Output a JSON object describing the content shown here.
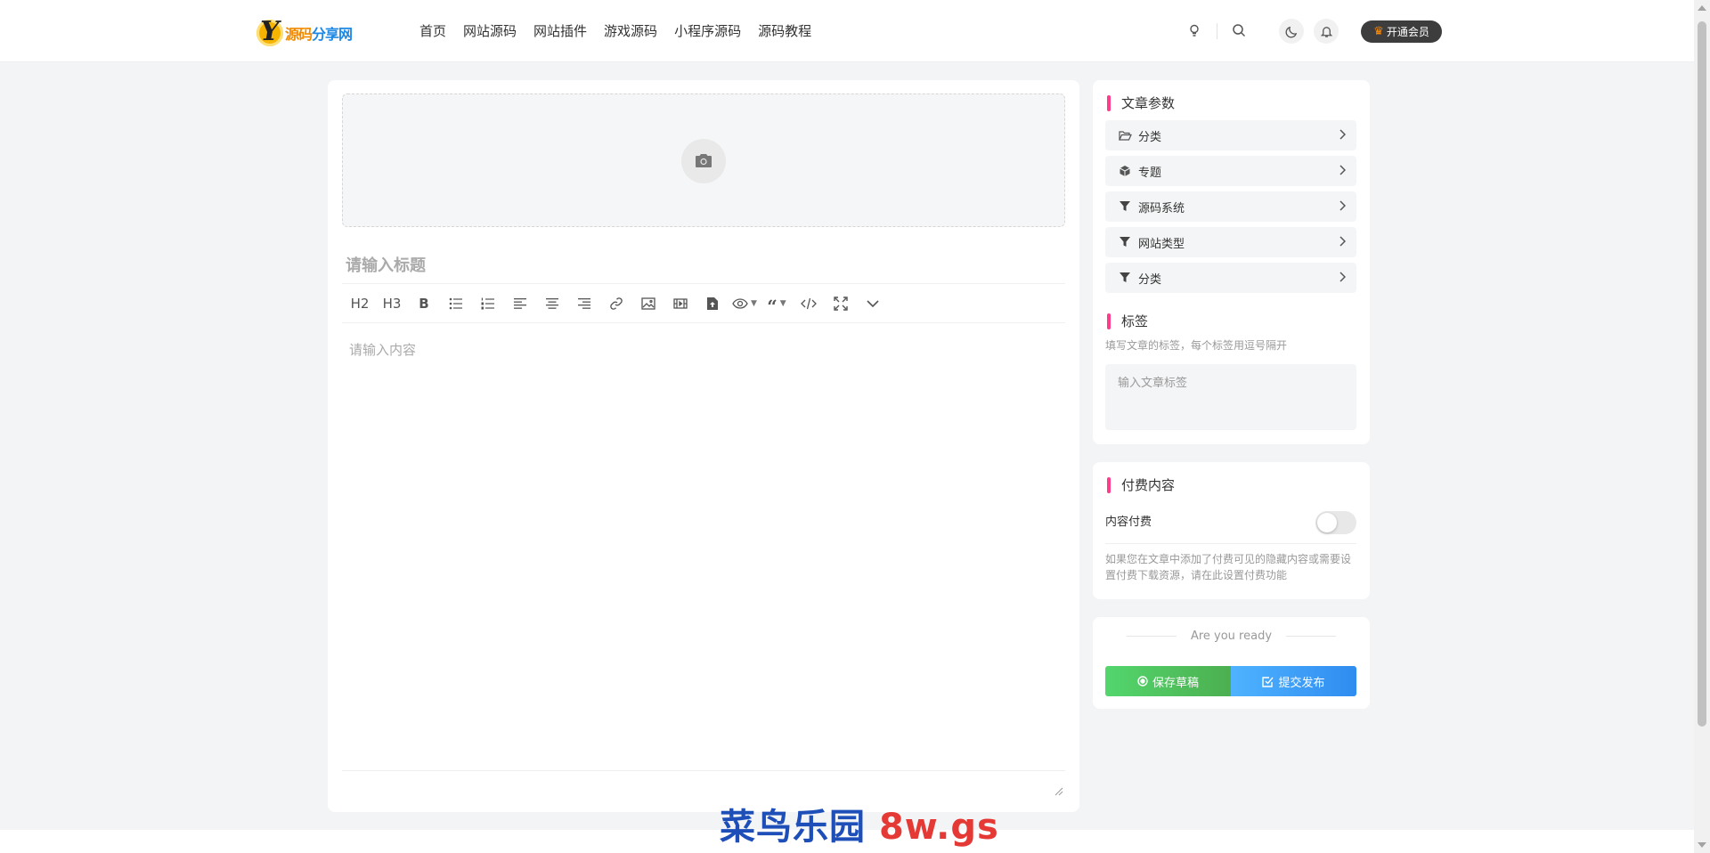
{
  "header": {
    "logo_text_a": "源码",
    "logo_text_b": "分享网",
    "nav": [
      "首页",
      "网站源码",
      "网站插件",
      "游戏源码",
      "小程序源码",
      "源码教程"
    ],
    "vip_label": "开通会员"
  },
  "editor": {
    "title_placeholder": "请输入标题",
    "content_placeholder": "请输入内容",
    "toolbar": {
      "h2": "H2",
      "h3": "H3",
      "bold": "B"
    }
  },
  "params": {
    "title": "文章参数",
    "rows": [
      {
        "label": "分类",
        "icon": "folder-open-icon"
      },
      {
        "label": "专题",
        "icon": "cube-icon"
      },
      {
        "label": "源码系统",
        "icon": "filter-icon"
      },
      {
        "label": "网站类型",
        "icon": "filter-icon"
      },
      {
        "label": "分类",
        "icon": "filter-icon"
      }
    ]
  },
  "tags": {
    "title": "标签",
    "hint": "填写文章的标签，每个标签用逗号隔开",
    "placeholder": "输入文章标签"
  },
  "paid": {
    "title": "付费内容",
    "toggle_label": "内容付费",
    "toggle_on": false,
    "description": "如果您在文章中添加了付费可见的隐藏内容或需要设置付费下载资源，请在此设置付费功能"
  },
  "publish": {
    "ready_text": "Are you ready",
    "save_label": "保存草稿",
    "submit_label": "提交发布"
  },
  "watermark": {
    "cn": "菜鸟乐园",
    "site": "8w.gs"
  },
  "colors": {
    "accent_bar": "#ff3c8b",
    "save_green": "#4caf50",
    "submit_blue": "#2f8cf0"
  }
}
